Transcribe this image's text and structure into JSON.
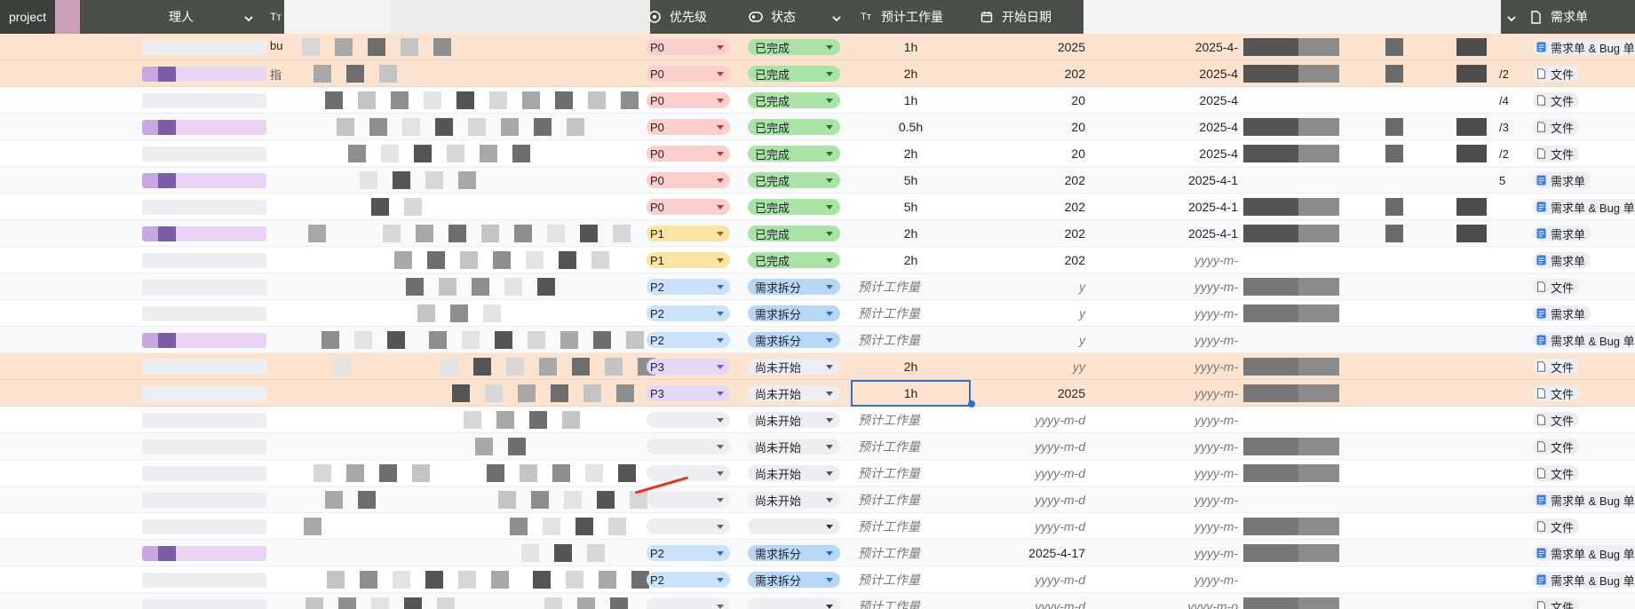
{
  "header": {
    "project": "project",
    "owner": "理人",
    "title_icon": "Tт",
    "priority": "优先级",
    "status": "状态",
    "effort": "预计工作量",
    "start_date": "开始日期",
    "requirement": "需求单"
  },
  "first_row_text": "bu",
  "second_row_text": "指",
  "placeholders": {
    "effort": "预计工作量",
    "start": "yyyy-m-d",
    "end": "yyyy-m-"
  },
  "rows": [
    {
      "pri": "P0",
      "st": "已完成",
      "eff": "1h",
      "sd": "2025",
      "ed": "2025-4-",
      "link": "",
      "req": "需求单 & Bug 单",
      "req_icon": "doc-blue"
    },
    {
      "pri": "P0",
      "st": "已完成",
      "eff": "2h",
      "sd": "202",
      "ed": "2025-4",
      "link": "/2",
      "req": "文件",
      "req_icon": "file"
    },
    {
      "pri": "P0",
      "st": "已完成",
      "eff": "1h",
      "sd": "20",
      "ed": "2025-4",
      "link": "/4",
      "req": "文件",
      "req_icon": "file"
    },
    {
      "pri": "P0",
      "st": "已完成",
      "eff": "0.5h",
      "sd": "20",
      "ed": "2025-4",
      "link": "/3",
      "req": "文件",
      "req_icon": "file"
    },
    {
      "pri": "P0",
      "st": "已完成",
      "eff": "2h",
      "sd": "20",
      "ed": "2025-4",
      "link": "/2",
      "req": "文件",
      "req_icon": "file"
    },
    {
      "pri": "P0",
      "st": "已完成",
      "eff": "5h",
      "sd": "202",
      "ed": "2025-4-1",
      "link": "5",
      "req": "需求单",
      "req_icon": "doc-blue"
    },
    {
      "pri": "P0",
      "st": "已完成",
      "eff": "5h",
      "sd": "202",
      "ed": "2025-4-1",
      "link": "",
      "req": "需求单 & Bug 单",
      "req_icon": "doc-blue"
    },
    {
      "pri": "P1",
      "st": "已完成",
      "eff": "2h",
      "sd": "202",
      "ed": "2025-4-1",
      "link": "",
      "req": "需求单",
      "req_icon": "doc-blue"
    },
    {
      "pri": "P1",
      "st": "已完成",
      "eff": "2h",
      "sd": "202",
      "ed": "yyyy-m-",
      "link": "",
      "req": "需求单",
      "req_icon": "doc-blue"
    },
    {
      "pri": "P2",
      "st": "需求拆分",
      "eff": "",
      "sd": "y",
      "ed": "yyyy-m-",
      "link": "",
      "req": "文件",
      "req_icon": "file"
    },
    {
      "pri": "P2",
      "st": "需求拆分",
      "eff": "",
      "sd": "y",
      "ed": "yyyy-m-",
      "link": "",
      "req": "需求单",
      "req_icon": "doc-blue"
    },
    {
      "pri": "P2",
      "st": "需求拆分",
      "eff": "",
      "sd": "y",
      "ed": "yyyy-m-",
      "link": "",
      "req": "需求单 & Bug 单",
      "req_icon": "doc-blue"
    },
    {
      "pri": "P3",
      "st": "尚未开始",
      "eff": "2h",
      "sd": "yy",
      "ed": "yyyy-m-",
      "link": "",
      "req": "文件",
      "req_icon": "file"
    },
    {
      "pri": "P3",
      "st": "尚未开始",
      "eff": "1h",
      "sd": "2025",
      "ed": "yyyy-m-",
      "link": "",
      "req": "文件",
      "req_icon": "file"
    },
    {
      "pri": "",
      "st": "尚未开始",
      "eff": "",
      "sd": "yyyy-m-d",
      "ed": "yyyy-m-",
      "link": "",
      "req": "文件",
      "req_icon": "file"
    },
    {
      "pri": "",
      "st": "尚未开始",
      "eff": "",
      "sd": "yyyy-m-d",
      "ed": "yyyy-m-",
      "link": "",
      "req": "文件",
      "req_icon": "file"
    },
    {
      "pri": "",
      "st": "尚未开始",
      "eff": "",
      "sd": "yyyy-m-d",
      "ed": "yyyy-m-",
      "link": "",
      "req": "文件",
      "req_icon": "file"
    },
    {
      "pri": "",
      "st": "尚未开始",
      "eff": "",
      "sd": "yyyy-m-d",
      "ed": "yyyy-m-",
      "link": "",
      "req": "需求单 & Bug 单",
      "req_icon": "doc-blue"
    },
    {
      "pri": "",
      "st": "",
      "eff": "",
      "sd": "yyyy-m-d",
      "ed": "yyyy-m-",
      "link": "",
      "req": "文件",
      "req_icon": "file"
    },
    {
      "pri": "P2",
      "st": "需求拆分",
      "eff": "",
      "sd": "2025-4-17",
      "ed": "yyyy-m-",
      "link": "",
      "req": "需求单 & Bug 单",
      "req_icon": "doc-blue"
    },
    {
      "pri": "P2",
      "st": "需求拆分",
      "eff": "",
      "sd": "yyyy-m-d",
      "ed": "yyyy-m-",
      "link": "",
      "req": "需求单 & Bug 单",
      "req_icon": "doc-blue"
    },
    {
      "pri": "",
      "st": "",
      "eff": "",
      "sd": "yyyy-m-d",
      "ed": "yyyy-m-o",
      "link": "",
      "req": "文件",
      "req_icon": "file"
    }
  ],
  "colors": {
    "header_bg": "#4a5048",
    "highlight_row": "#fce3cf",
    "selection": "#2f6fcf"
  }
}
